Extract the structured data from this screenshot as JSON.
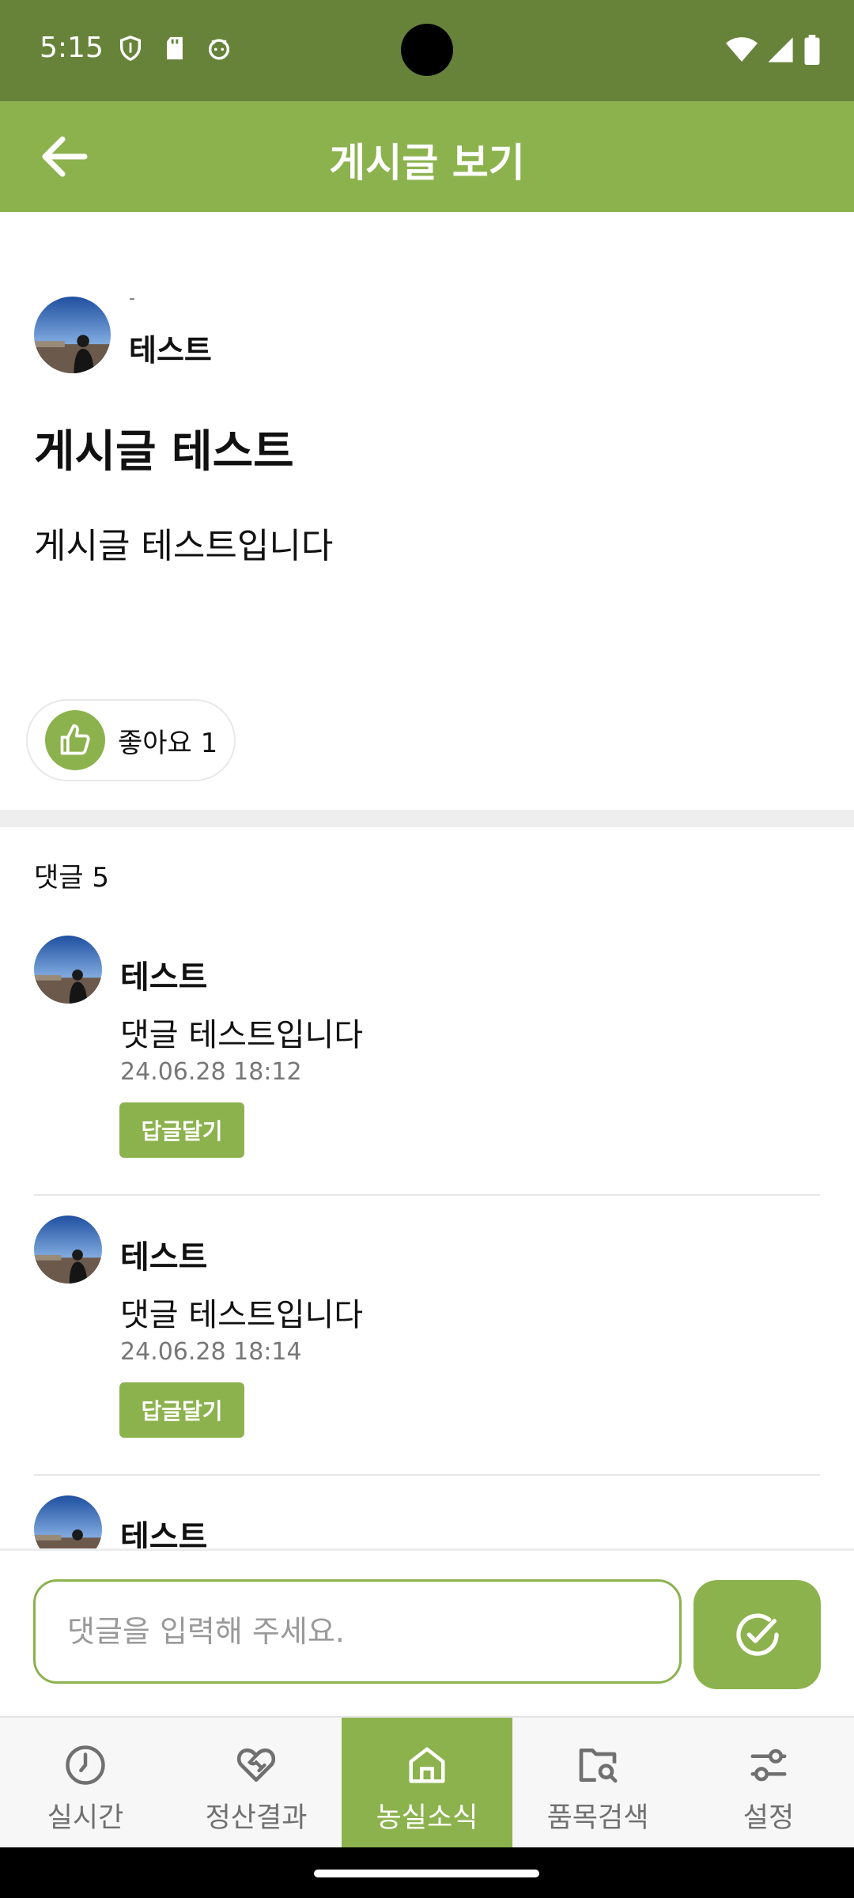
{
  "status_bar": {
    "time": "5:15",
    "left_icons": [
      "shield-icon",
      "sd-card-icon",
      "android-face-icon"
    ],
    "right_icons": [
      "wifi-icon",
      "signal-icon",
      "battery-icon"
    ]
  },
  "app_bar": {
    "title": "게시글 보기",
    "back_icon": "arrow-left-icon"
  },
  "post": {
    "author_prefix": "-",
    "author": "테스트",
    "title": "게시글 테스트",
    "body": "게시글 테스트입니다",
    "like_label": "좋아요 1"
  },
  "comments": {
    "count_label": "댓글 5",
    "reply_label": "답글달기",
    "items": [
      {
        "author": "테스트",
        "text": "댓글 테스트입니다",
        "date": "24.06.28 18:12"
      },
      {
        "author": "테스트",
        "text": "댓글 테스트입니다",
        "date": "24.06.28 18:14"
      },
      {
        "author": "테스트"
      }
    ]
  },
  "input": {
    "placeholder": "댓글을 입력해 주세요.",
    "submit_icon": "check-circle-icon"
  },
  "bottom_nav": {
    "items": [
      {
        "label": "실시간",
        "icon": "clock-icon"
      },
      {
        "label": "정산결과",
        "icon": "heart-handshake-icon"
      },
      {
        "label": "농실소식",
        "icon": "home-icon"
      },
      {
        "label": "품목검색",
        "icon": "folder-search-icon"
      },
      {
        "label": "설정",
        "icon": "sliders-icon"
      }
    ],
    "active_label": "농실소식"
  },
  "colors": {
    "status_bar": "#67833a",
    "accent": "#8cb24e"
  }
}
